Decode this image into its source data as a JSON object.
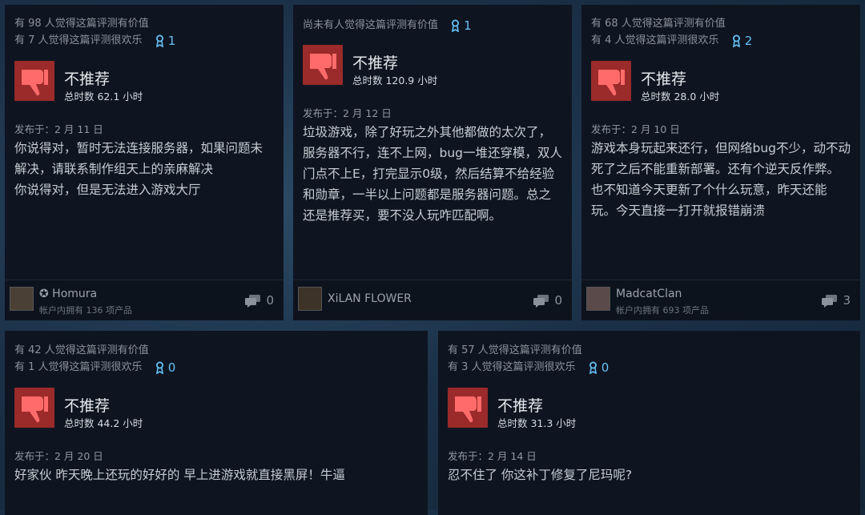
{
  "reviews": [
    {
      "helpful": "有 98 人觉得这篇评测有价值",
      "funny": "有 7 人觉得这篇评测很欢乐",
      "awards": "1",
      "verdict": "不推荐",
      "hours": "总时数 62.1 小时",
      "posted": "发布于：2 月 11 日",
      "body": "你说得对，暂时无法连接服务器，如果问题未解决，请联系制作组天上的亲麻解决\n你说得对，但是无法进入游戏大厅",
      "author": "✪ Homura",
      "owned": "帐户内拥有 136 项产品",
      "comments": "0"
    },
    {
      "helpful": "尚未有人觉得这篇评测有价值",
      "awards": "1",
      "verdict": "不推荐",
      "hours": "总时数 120.9 小时",
      "posted": "发布于：2 月 12 日",
      "body": "垃圾游戏，除了好玩之外其他都做的太次了，服务器不行，连不上网，bug一堆还穿模，双人门点不上E，打完显示0级，然后结算不给经验和勋章，一半以上问题都是服务器问题。总之还是推荐买，要不没人玩咋匹配啊。",
      "author": "XiLAN FLOWER",
      "comments": "0"
    },
    {
      "helpful": "有 68 人觉得这篇评测有价值",
      "funny": "有 4 人觉得这篇评测很欢乐",
      "awards": "2",
      "verdict": "不推荐",
      "hours": "总时数 28.0 小时",
      "posted": "发布于：2 月 10 日",
      "body": "游戏本身玩起来还行，但网络bug不少，动不动死了之后不能重新部署。还有个逆天反作弊。也不知道今天更新了个什么玩意，昨天还能玩。今天直接一打开就报错崩溃",
      "author": "MadcatClan",
      "owned": "帐户内拥有 693 项产品",
      "comments": "3"
    },
    {
      "helpful": "有 42 人觉得这篇评测有价值",
      "funny": "有 1 人觉得这篇评测很欢乐",
      "awards": "0",
      "verdict": "不推荐",
      "hours": "总时数 44.2 小时",
      "posted": "发布于：2 月 20 日",
      "body": "好家伙 昨天晚上还玩的好好的 早上进游戏就直接黑屏！牛逼"
    },
    {
      "helpful": "有 57 人觉得这篇评测有价值",
      "funny": "有 3 人觉得这篇评测很欢乐",
      "awards": "0",
      "verdict": "不推荐",
      "hours": "总时数 31.3 小时",
      "posted": "发布于：2 月 14 日",
      "body": "忍不住了 你这补丁修复了尼玛呢?"
    }
  ],
  "icons": {
    "award": "award-ribbon-icon",
    "thumb": "thumbs-down-icon",
    "comment": "comment-bubbles-icon"
  },
  "colors": {
    "card_bg": "#0e1521",
    "thumb_bg": "#9b2a2a",
    "award": "#66c0f4",
    "verdict": "#e6e9ec"
  }
}
